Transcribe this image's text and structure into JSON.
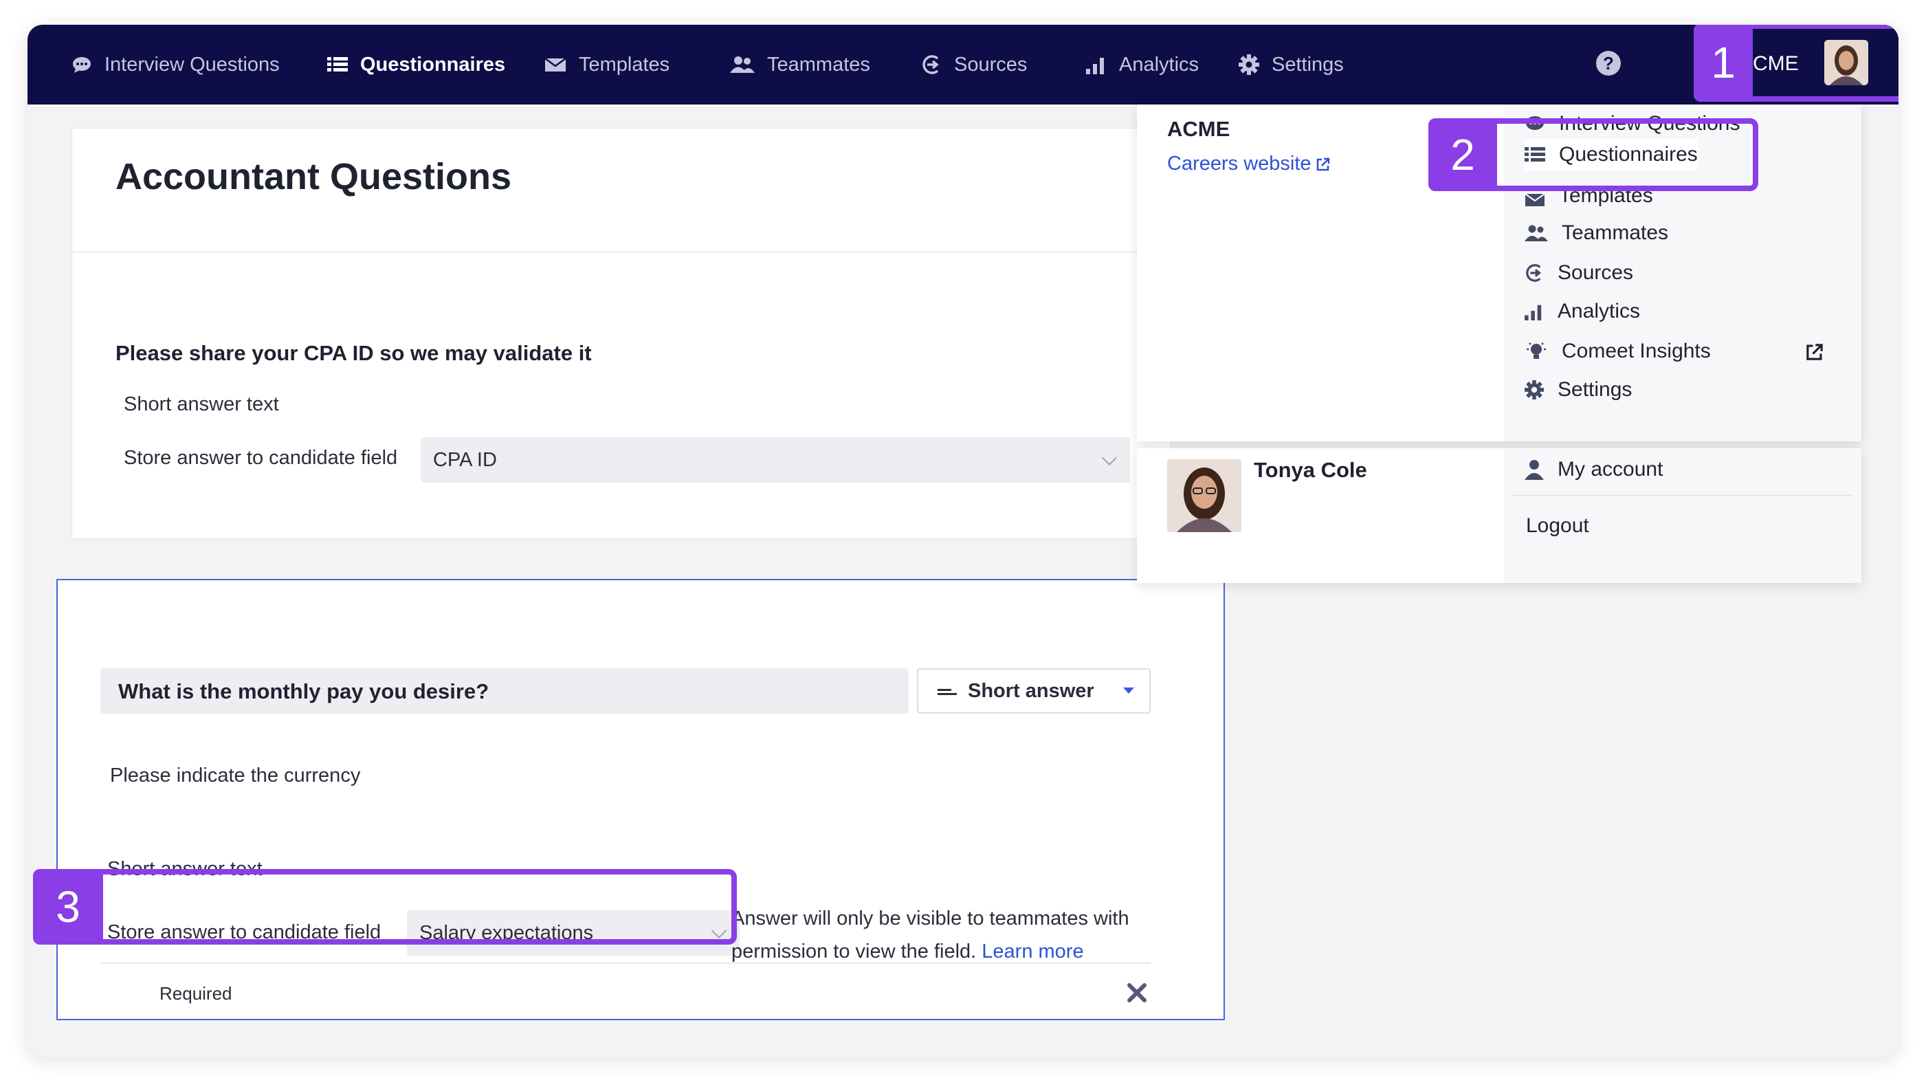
{
  "nav": {
    "items": [
      {
        "label": "Interview Questions",
        "icon": "chat-icon"
      },
      {
        "label": "Questionnaires",
        "icon": "list-icon",
        "active": true
      },
      {
        "label": "Templates",
        "icon": "envelope-icon"
      },
      {
        "label": "Teammates",
        "icon": "users-icon"
      },
      {
        "label": "Sources",
        "icon": "sources-icon"
      },
      {
        "label": "Analytics",
        "icon": "bar-chart-icon"
      },
      {
        "label": "Settings",
        "icon": "gear-icon"
      }
    ],
    "help_glyph": "?",
    "company": "ACME"
  },
  "badges": {
    "one": "1",
    "two": "2",
    "three": "3"
  },
  "page": {
    "title": "Accountant Questions",
    "q1": {
      "label": "Please share your CPA ID so we may validate it",
      "answer_type_text": "Short answer text",
      "store_label": "Store answer to candidate field",
      "field_value": "CPA ID"
    },
    "q2": {
      "label": "What is the monthly pay you desire?",
      "type_button": "Short answer",
      "description": "Please indicate the currency",
      "answer_type_text": "Short answer text",
      "store_label": "Store answer to candidate field",
      "field_value": "Salary expectations",
      "hint": "Answer will only be visible to teammates with permission to view the field.",
      "learn_more": "Learn more",
      "required": "Required"
    }
  },
  "dropdown": {
    "company": "ACME",
    "careers_link": "Careers website",
    "items": [
      {
        "label": "Interview Questions",
        "icon": "chat-icon"
      },
      {
        "label": "Questionnaires",
        "icon": "list-icon"
      },
      {
        "label": "Templates",
        "icon": "envelope-icon"
      },
      {
        "label": "Teammates",
        "icon": "users-icon"
      },
      {
        "label": "Sources",
        "icon": "sources-icon"
      },
      {
        "label": "Analytics",
        "icon": "bar-chart-icon"
      },
      {
        "label": "Comeet Insights",
        "icon": "lightbulb-icon"
      },
      {
        "label": "Settings",
        "icon": "gear-icon"
      }
    ],
    "user_name": "Tonya Cole",
    "my_account": "My account",
    "logout": "Logout"
  },
  "colors": {
    "navy": "#0e0d47",
    "accent": "#8a3ee6",
    "link": "#2f50d8"
  }
}
